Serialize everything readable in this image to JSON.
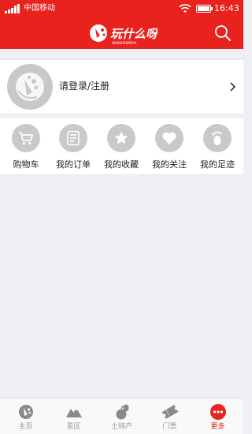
{
  "status_bar": {
    "carrier": "中国移动",
    "time": "16:43"
  },
  "header": {
    "logo_text": "玩什么呀",
    "logo_subtext": "WANSHENMEYA",
    "search_icon": "search-icon"
  },
  "account": {
    "login_label": "请登录/注册",
    "avatar_icon": "brand-avatar-icon",
    "chevron_icon": "chevron-right-icon"
  },
  "shortcuts": [
    {
      "label": "购物车",
      "icon": "cart-icon"
    },
    {
      "label": "我的订单",
      "icon": "order-icon"
    },
    {
      "label": "我的收藏",
      "icon": "star-icon"
    },
    {
      "label": "我的关注",
      "icon": "heart-icon"
    },
    {
      "label": "我的足迹",
      "icon": "footprint-icon"
    }
  ],
  "tabbar": {
    "active": "更多",
    "items": [
      {
        "label": "主页",
        "icon": "home-logo-icon"
      },
      {
        "label": "景区",
        "icon": "mountain-icon"
      },
      {
        "label": "土特产",
        "icon": "produce-icon"
      },
      {
        "label": "门票",
        "icon": "ticket-icon"
      },
      {
        "label": "更多",
        "icon": "more-dots-icon"
      }
    ]
  },
  "colors": {
    "brand_red": "#e8231d",
    "icon_gray": "#c9c9c9",
    "page_bg": "#eef0f3",
    "tab_inactive": "#999999"
  }
}
